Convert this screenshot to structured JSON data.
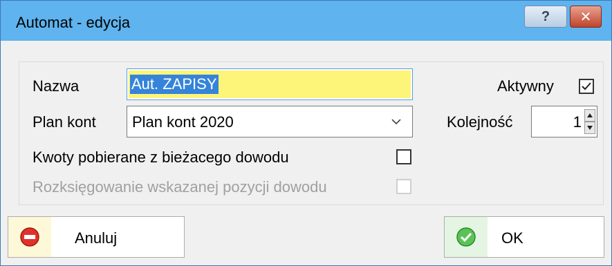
{
  "window": {
    "title": "Automat - edycja"
  },
  "titlebar": {
    "help_label": "?",
    "close_label": "✕"
  },
  "form": {
    "nazwa_label": "Nazwa",
    "nazwa_value": "Aut. ZAPISY",
    "plan_label": "Plan kont",
    "plan_value": "Plan kont 2020",
    "kwoty_label": "Kwoty pobierane z bieżacego dowodu",
    "kwoty_checked": false,
    "rozks_label": "Rozksięgowanie wskazanej pozycji dowodu",
    "rozks_checked": false,
    "aktywny_label": "Aktywny",
    "aktywny_checked": true,
    "kolejnosc_label": "Kolejność",
    "kolejnosc_value": "1"
  },
  "buttons": {
    "cancel_label": "Anuluj",
    "ok_label": "OK"
  },
  "icons": {
    "cancel": "no-entry-icon",
    "ok": "check-circle-icon",
    "dropdown": "chevron-down-icon"
  },
  "colors": {
    "titlebar": "#5fb3ee",
    "selection": "#3584d9",
    "input_highlight": "#fdf57a"
  }
}
